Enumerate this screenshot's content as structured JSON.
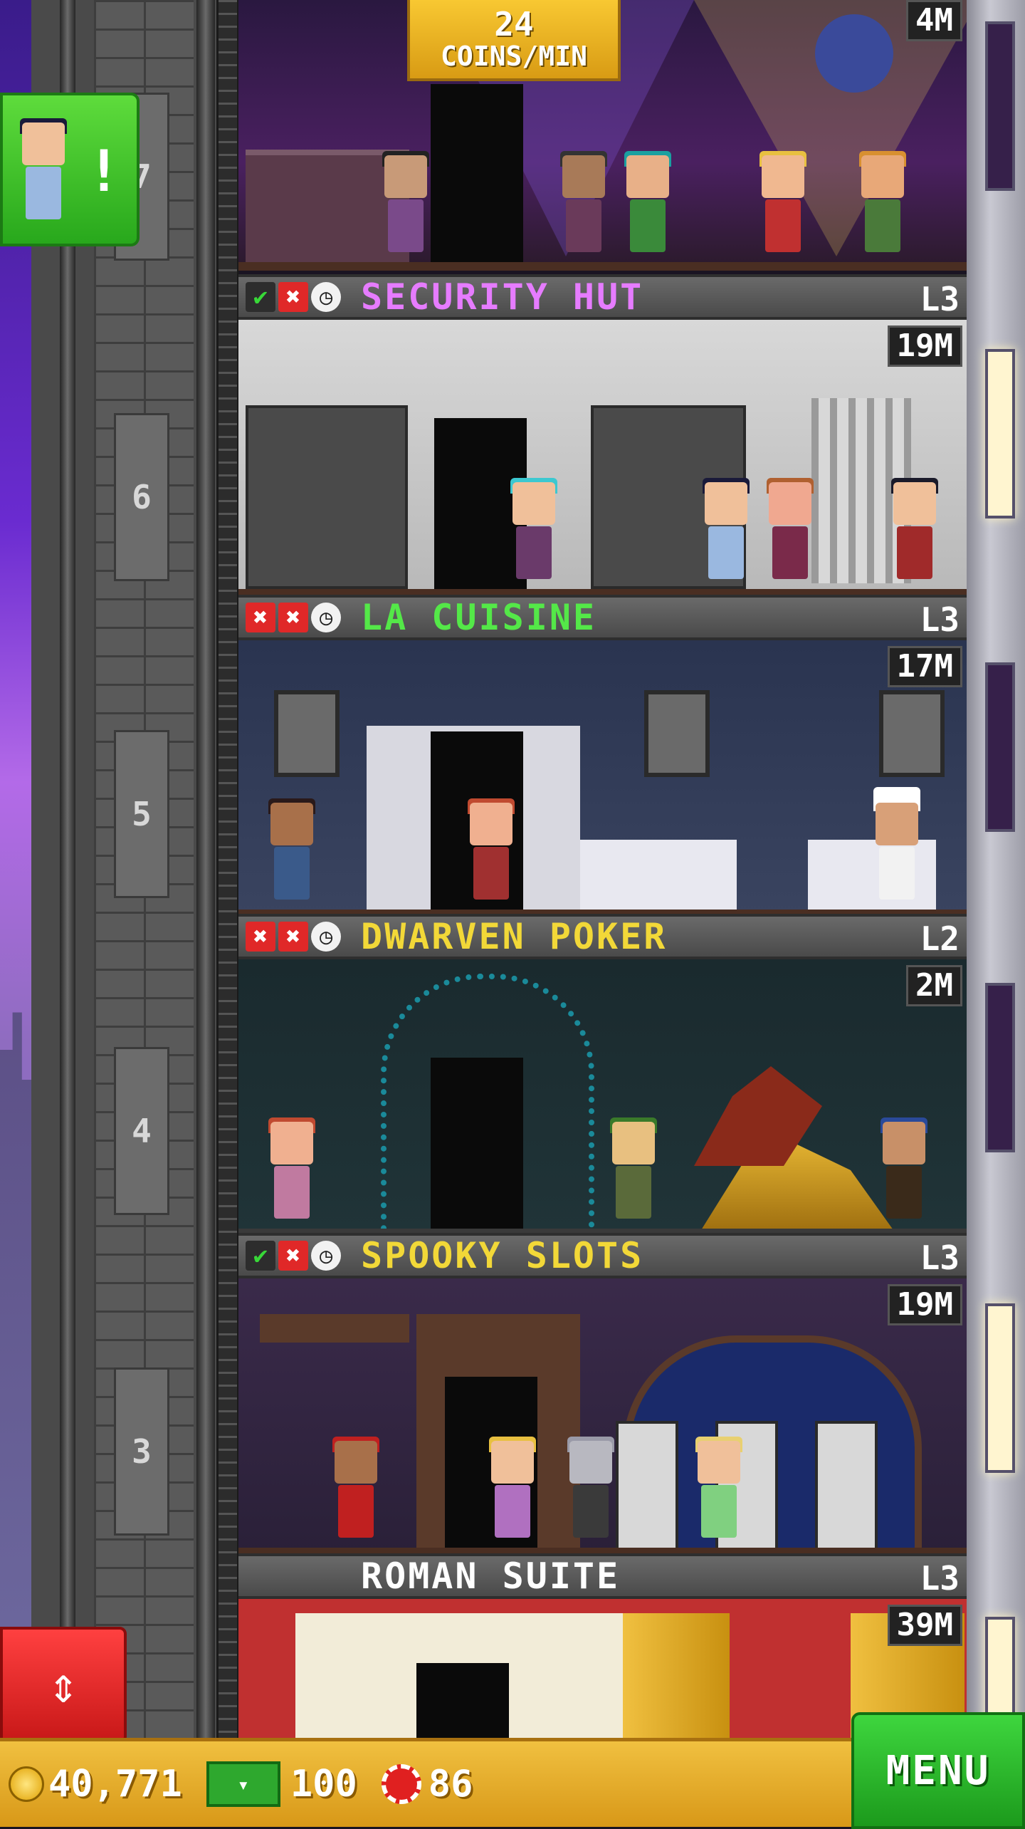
{
  "top_room": {
    "coin_rate_value": "24",
    "coin_rate_unit": "COINS/MIN",
    "stock": "4M",
    "floor_number": "7"
  },
  "notification": {
    "icon": "security-guard-avatar",
    "mark": "!"
  },
  "floors": [
    {
      "floor_number": "6",
      "name": "SECURITY HUT",
      "name_color": "#e67cff",
      "level": "L3",
      "stock": "19M",
      "status": [
        "check",
        "x",
        "clock"
      ]
    },
    {
      "floor_number": "5",
      "name": "LA CUISINE",
      "name_color": "#54e848",
      "level": "L3",
      "stock": "17M",
      "status": [
        "x",
        "x",
        "clock"
      ]
    },
    {
      "floor_number": "4",
      "name": "DWARVEN POKER",
      "name_color": "#f2d838",
      "level": "L2",
      "stock": "2M",
      "status": [
        "x",
        "x",
        "clock"
      ]
    },
    {
      "floor_number": "3",
      "name": "SPOOKY SLOTS",
      "name_color": "#f2d838",
      "level": "L3",
      "stock": "19M",
      "status": [
        "check",
        "x",
        "clock"
      ]
    },
    {
      "floor_number": "",
      "name": "ROMAN SUITE",
      "name_color": "#ffffff",
      "level": "L3",
      "stock": "39M",
      "status": [
        "person",
        "person",
        "person"
      ]
    }
  ],
  "bottom_bar": {
    "coins": "40,771",
    "bux": "100",
    "chips": "86",
    "menu_label": "MENU"
  }
}
